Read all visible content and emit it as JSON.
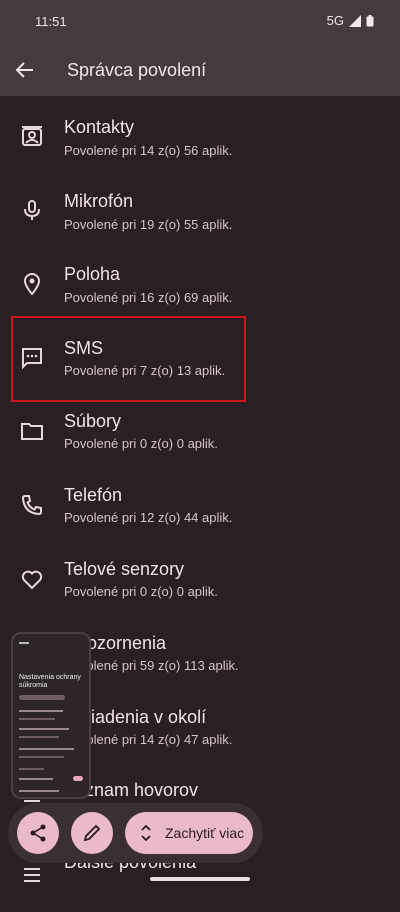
{
  "status": {
    "time": "11:51",
    "network": "5G"
  },
  "app_bar": {
    "title": "Správca povolení"
  },
  "items": [
    {
      "label": "Kontakty",
      "sub": "Povolené pri 14 z(o) 56 aplik.",
      "icon": "contact-card-icon"
    },
    {
      "label": "Mikrofón",
      "sub": "Povolené pri 19 z(o) 55 aplik.",
      "icon": "microphone-icon"
    },
    {
      "label": "Poloha",
      "sub": "Povolené pri 16 z(o) 69 aplik.",
      "icon": "location-pin-icon"
    },
    {
      "label": "SMS",
      "sub": "Povolené pri 7 z(o) 13 aplik.",
      "icon": "sms-icon"
    },
    {
      "label": "Súbory",
      "sub": "Povolené pri 0 z(o) 0 aplik.",
      "icon": "folder-icon"
    },
    {
      "label": "Telefón",
      "sub": "Povolené pri 12 z(o) 44 aplik.",
      "icon": "phone-icon"
    },
    {
      "label": "Telové senzory",
      "sub": "Povolené pri 0 z(o) 0 aplik.",
      "icon": "heart-icon"
    },
    {
      "label": "Upozornenia",
      "sub": "Povolené pri 59 z(o) 113 aplik.",
      "icon": "bell-icon"
    },
    {
      "label": "Zariadenia v okolí",
      "sub": "Povolené pri 14 z(o) 47 aplik.",
      "icon": "nearby-devices-icon"
    },
    {
      "label": "Zoznam hovorov",
      "sub": "",
      "icon": "call-log-icon"
    },
    {
      "label": "Ďalšie povolenia",
      "sub": "",
      "icon": "more-permissions-icon"
    }
  ],
  "screenshot_preview": {
    "title": "Nastavenia ochrany súkromia"
  },
  "toolbar": {
    "capture_more_label": "Zachytiť viac"
  }
}
